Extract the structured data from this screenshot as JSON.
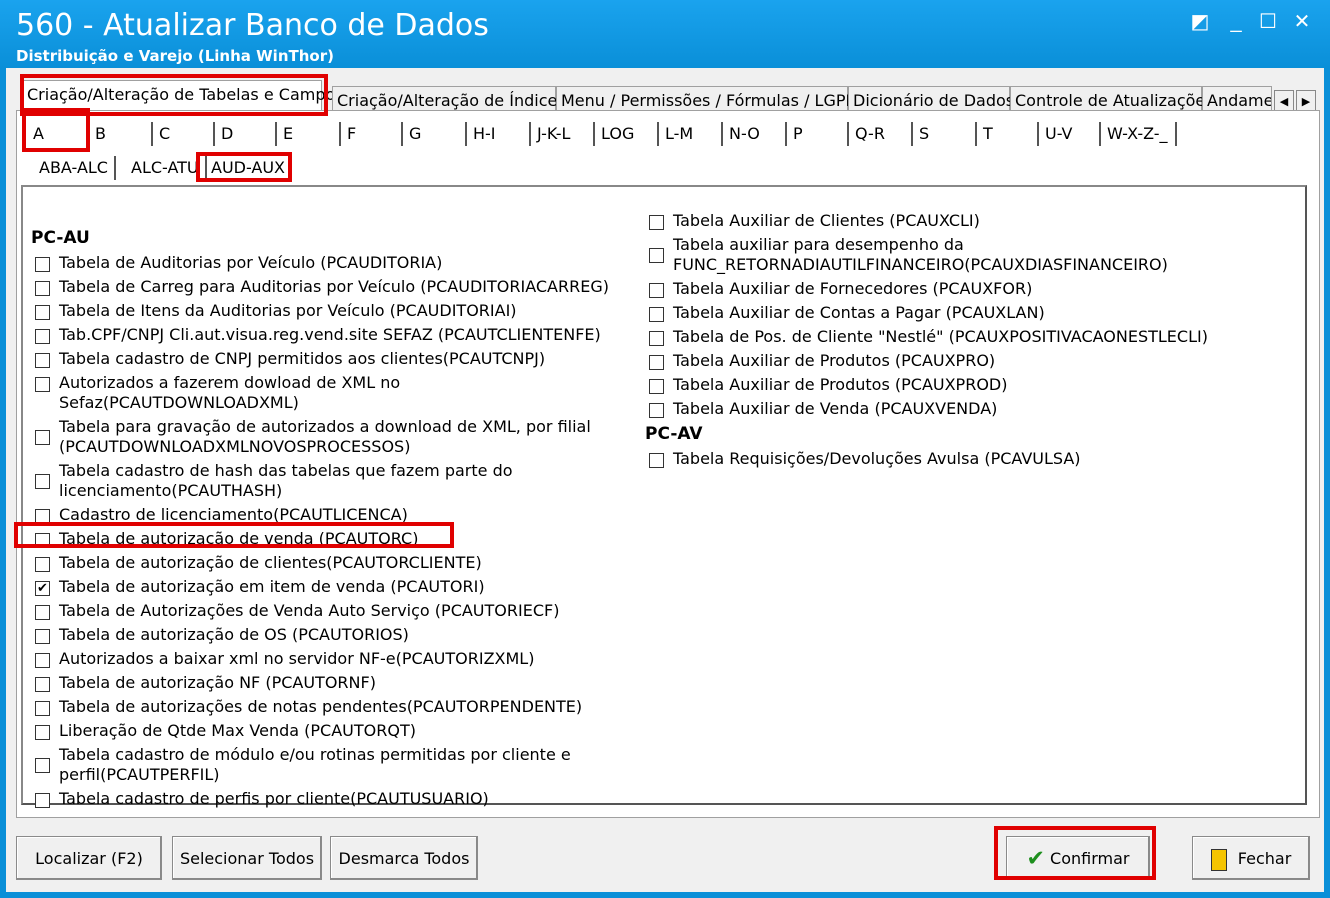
{
  "window": {
    "title": "560 - Atualizar Banco de Dados",
    "subtitle": "Distribuição e Varejo (Linha WinThor)"
  },
  "main_tabs": [
    {
      "label": "Criação/Alteração de Tabelas e Campos",
      "active": true
    },
    {
      "label": "Criação/Alteração de Índices"
    },
    {
      "label": "Menu / Permissões / Fórmulas / LGPD"
    },
    {
      "label": "Dicionário de Dados"
    },
    {
      "label": "Controle de Atualizações"
    },
    {
      "label": "Andame"
    }
  ],
  "letter_tabs": [
    "A",
    "B",
    "C",
    "D",
    "E",
    "F",
    "G",
    "H-I",
    "J-K-L",
    "LOG",
    "L-M",
    "N-O",
    "P",
    "Q-R",
    "S",
    "T",
    "U-V",
    "W-X-Z-_"
  ],
  "sub_tabs": [
    "ABA-ALC",
    "ALC-ATU",
    "AUD-AUX"
  ],
  "left_group": "PC-AU",
  "left_items": [
    {
      "label": "Tabela de Auditorias por Veículo (PCAUDITORIA)",
      "checked": false
    },
    {
      "label": "Tabela de Carreg para Auditorias por Veículo (PCAUDITORIACARREG)",
      "checked": false
    },
    {
      "label": "Tabela de Itens da Auditorias por Veículo (PCAUDITORIAI)",
      "checked": false
    },
    {
      "label": "Tab.CPF/CNPJ Cli.aut.visua.reg.vend.site SEFAZ (PCAUTCLIENTENFE)",
      "checked": false
    },
    {
      "label": "Tabela cadastro de CNPJ permitidos aos clientes(PCAUTCNPJ)",
      "checked": false
    },
    {
      "label": "Autorizados a fazerem dowload de XML no Sefaz(PCAUTDOWNLOADXML)",
      "checked": false
    },
    {
      "label": "Tabela para gravação de autorizados a download de XML, por filial",
      "label2": "(PCAUTDOWNLOADXMLNOVOSPROCESSOS)",
      "checked": false
    },
    {
      "label": "Tabela cadastro de hash das tabelas que fazem parte do",
      "label2": "licenciamento(PCAUTHASH)",
      "checked": false
    },
    {
      "label": "Cadastro de licenciamento(PCAUTLICENCA)",
      "checked": false
    },
    {
      "label": "Tabela de autorização de venda (PCAUTORC)",
      "checked": false
    },
    {
      "label": "Tabela de autorização de clientes(PCAUTORCLIENTE)",
      "checked": false
    },
    {
      "label": "Tabela de autorização em item de venda (PCAUTORI)",
      "checked": true
    },
    {
      "label": "Tabela de Autorizações de Venda Auto Serviço (PCAUTORIECF)",
      "checked": false
    },
    {
      "label": "Tabela de autorização de OS (PCAUTORIOS)",
      "checked": false
    },
    {
      "label": "Autorizados a baixar xml no servidor NF-e(PCAUTORIZXML)",
      "checked": false
    },
    {
      "label": "Tabela de autorização NF (PCAUTORNF)",
      "checked": false
    },
    {
      "label": "Tabela de autorizações de notas pendentes(PCAUTORPENDENTE)",
      "checked": false
    },
    {
      "label": "Liberação de Qtde Max Venda (PCAUTORQT)",
      "checked": false
    },
    {
      "label": "Tabela cadastro de módulo e/ou rotinas permitidas por cliente e",
      "label2": "perfil(PCAUTPERFIL)",
      "checked": false
    },
    {
      "label": "Tabela cadastro de perfis por cliente(PCAUTUSUARIO)",
      "checked": false
    }
  ],
  "right_items": [
    {
      "label": "Tabela Auxiliar de Clientes (PCAUXCLI)",
      "checked": false
    },
    {
      "label": "Tabela auxiliar para desempenho da",
      "label2": "FUNC_RETORNADIAUTILFINANCEIRO(PCAUXDIASFINANCEIRO)",
      "checked": false
    },
    {
      "label": "Tabela Auxiliar de Fornecedores (PCAUXFOR)",
      "checked": false
    },
    {
      "label": "Tabela Auxiliar de Contas a Pagar (PCAUXLAN)",
      "checked": false
    },
    {
      "label": "Tabela de Pos. de Cliente \"Nestlé\" (PCAUXPOSITIVACAONESTLECLI)",
      "checked": false
    },
    {
      "label": "Tabela Auxiliar de Produtos (PCAUXPRO)",
      "checked": false
    },
    {
      "label": "Tabela Auxiliar de Produtos (PCAUXPROD)",
      "checked": false
    },
    {
      "label": "Tabela Auxiliar de Venda (PCAUXVENDA)",
      "checked": false
    }
  ],
  "right_group2": "PC-AV",
  "right_items2": [
    {
      "label": "Tabela Requisições/Devoluções Avulsa (PCAVULSA)",
      "checked": false
    }
  ],
  "buttons": {
    "localizar": "Localizar (F2)",
    "selecionar": "Selecionar Todos",
    "desmarca": "Desmarca Todos",
    "confirmar": "Confirmar",
    "fechar": "Fechar"
  },
  "colors": {
    "title_bar": "#0a8fd8",
    "highlight": "#e00000",
    "check": "#1e8f1e"
  }
}
